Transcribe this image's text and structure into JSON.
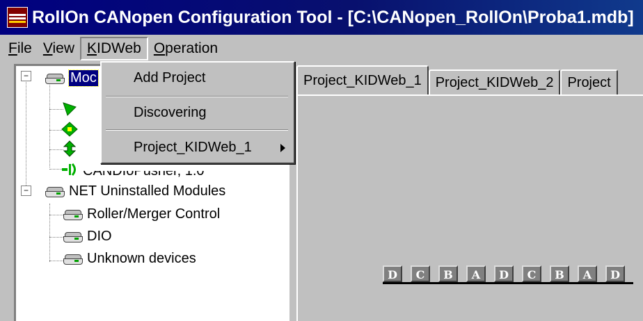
{
  "window": {
    "title": "RollOn CANopen Configuration Tool - [C:\\CANopen_RollOn\\Proba1.mdb]"
  },
  "menubar": {
    "items": [
      {
        "label": "File"
      },
      {
        "label": "View"
      },
      {
        "label": "KIDWeb"
      },
      {
        "label": "Operation"
      }
    ]
  },
  "dropdown": {
    "items": [
      {
        "label": "Add Project"
      },
      {
        "label": "Discovering"
      },
      {
        "label": "Project_KIDWeb_1"
      }
    ]
  },
  "tree": {
    "root_partial": "Moc",
    "obscured_node": "CANDIoPusher, 1.0",
    "uninstalled": {
      "label": "NET Uninstalled Modules",
      "children": [
        {
          "label": "Roller/Merger Control"
        },
        {
          "label": "DIO"
        },
        {
          "label": "Unknown devices"
        }
      ]
    }
  },
  "tabs": [
    {
      "label": "Project_KIDWeb_1"
    },
    {
      "label": "Project_KIDWeb_2"
    },
    {
      "label": "Project"
    }
  ],
  "conveyor": {
    "cells": [
      "D",
      "C",
      "B",
      "A",
      "D",
      "C",
      "B",
      "A",
      "D"
    ]
  },
  "colors": {
    "title_bar": "#000080",
    "selection": "#000080",
    "face": "#c0c0c0"
  },
  "icons": {
    "app": "rollon-app-icon",
    "module": "module-rack-icon",
    "device": "green-device-icon"
  }
}
